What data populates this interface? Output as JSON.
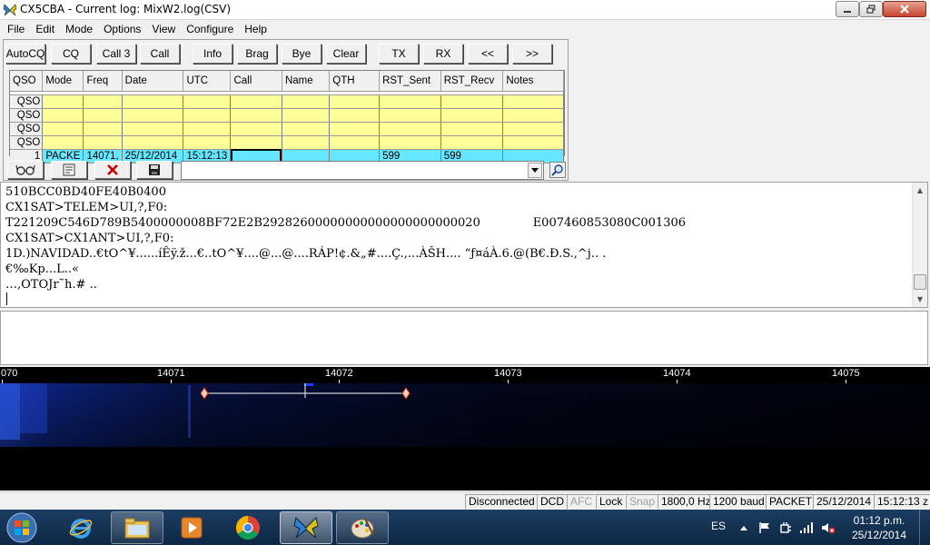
{
  "window": {
    "title": "CX5CBA - Current log: MixW2.log(CSV)"
  },
  "menu": [
    "File",
    "Edit",
    "Mode",
    "Options",
    "View",
    "Configure",
    "Help"
  ],
  "toolbar": {
    "autocq": "AutoCQ",
    "cq": "CQ",
    "call3": "Call 3",
    "call": "Call",
    "info": "Info",
    "brag": "Brag",
    "bye": "Bye",
    "clear": "Clear",
    "tx": "TX",
    "rx": "RX",
    "prev": "<<",
    "next": ">>"
  },
  "log_table": {
    "columns": [
      "QSO",
      "Mode",
      "Freq",
      "Date",
      "UTC",
      "Call",
      "Name",
      "QTH",
      "RST_Sent",
      "RST_Recv",
      "Notes"
    ],
    "empty_rows": [
      "QSO",
      "QSO",
      "QSO",
      "QSO"
    ],
    "active_row": {
      "num": "1",
      "mode": "PACKE",
      "freq": "14071,",
      "date": "25/12/2014",
      "utc": "15:12:13",
      "call": "",
      "name": "",
      "qth": "",
      "rst_sent": "599",
      "rst_recv": "599",
      "notes": ""
    }
  },
  "icons": {
    "glasses": "glasses-icon",
    "form": "form-icon",
    "delete": "delete-icon",
    "save": "save-icon",
    "lookup": "lookup-icon"
  },
  "callsign_combo": {
    "value": ""
  },
  "rx_lines": [
    "510BCC0BD40FE40B0400",
    "CX1SAT>TELEM>UI,?,F0:",
    "T221209C546D789B5400000008BF72E2B29282600000000000000000000020              E007460853080C001306",
    "CX1SAT>CX1ANT>UI,?,F0:",
    "1D.)NAVIDAD..€tO^¥......íÊÿ.ž...€..tO^¥....@...@....RÁP!¢.&„#....Ç.,...ÀŠH.... “ƒ¤áÀ.6.@(B€.Ð.S.,^j.. .",
    "€‰Kp...L..«",
    "…,OTOJr˜h.# .."
  ],
  "waterfall": {
    "freq_labels": [
      "070",
      "14071",
      "14072",
      "14073",
      "14074",
      "14075"
    ]
  },
  "status": {
    "connection": "Disconnected",
    "dcd": "DCD",
    "afc": "AFC",
    "lock": "Lock",
    "snap": "Snap",
    "audio_freq": "1800,0 Hz",
    "baud": "1200 baud",
    "mode": "PACKET",
    "date": "25/12/2014",
    "time": "15:12:13 z"
  },
  "taskbar": {
    "lang": "ES",
    "clock_time": "01:12 p.m.",
    "clock_date": "25/12/2014"
  },
  "colors": {
    "grid_empty": "#ffff99",
    "grid_active": "#66e6ff",
    "waterfall_bg": "#000000",
    "taskbar": "#1d3d63"
  }
}
